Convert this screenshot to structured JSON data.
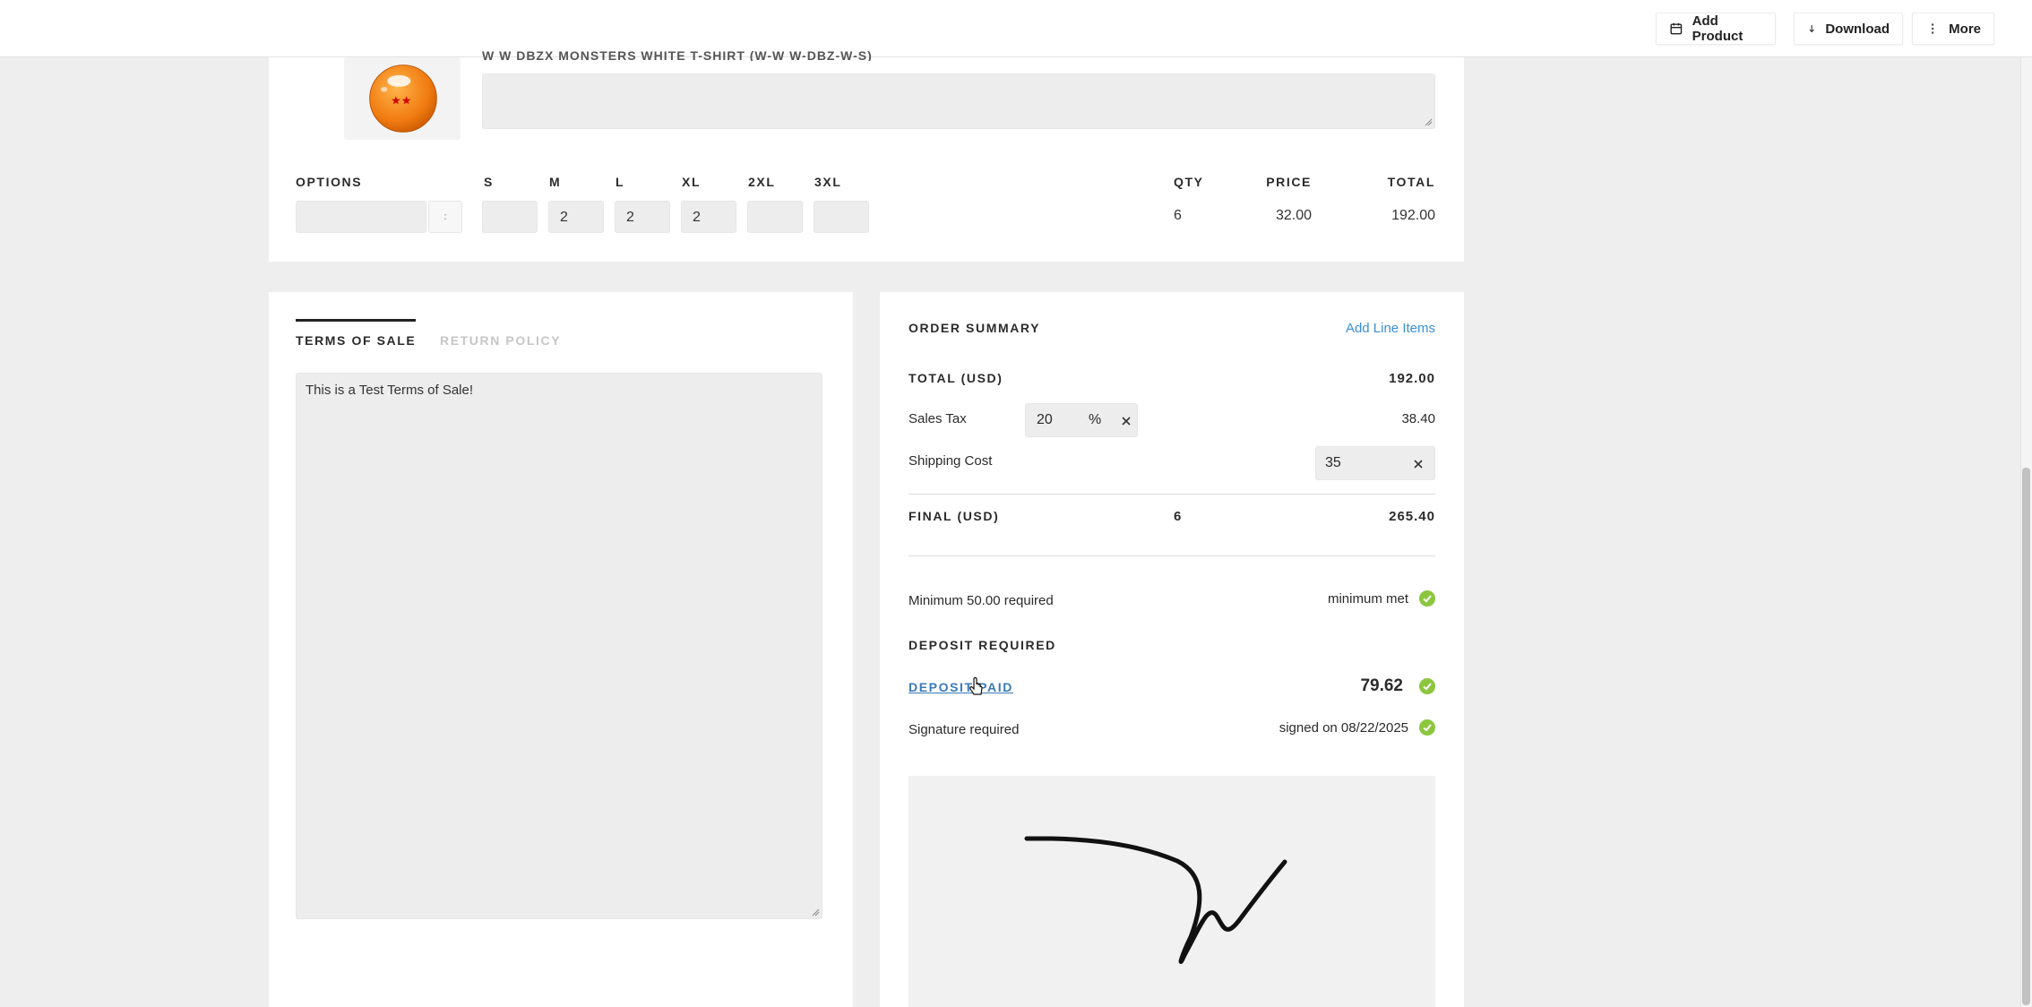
{
  "toolbar": {
    "add_product": "Add Product",
    "download": "Download",
    "more": "More"
  },
  "product": {
    "title_partial": "W W DBZX MONSTERS WHITE T-SHIRT (W-W W-DBZ-W-S)",
    "options_header": "OPTIONS",
    "sizes": [
      {
        "label": "S",
        "value": ""
      },
      {
        "label": "M",
        "value": "2"
      },
      {
        "label": "L",
        "value": "2"
      },
      {
        "label": "XL",
        "value": "2"
      },
      {
        "label": "2XL",
        "value": ""
      },
      {
        "label": "3XL",
        "value": ""
      }
    ],
    "qty_header": "QTY",
    "price_header": "PRICE",
    "total_header": "TOTAL",
    "qty": "6",
    "price": "32.00",
    "total": "192.00"
  },
  "terms": {
    "tab_terms": "TERMS OF SALE",
    "tab_return": "RETURN POLICY",
    "text": "This is a Test Terms of Sale!"
  },
  "summary": {
    "heading": "ORDER SUMMARY",
    "add_line_items": "Add Line Items",
    "total_label": "TOTAL (USD)",
    "total_value": "192.00",
    "sales_tax_label": "Sales Tax",
    "sales_tax_rate": "20",
    "sales_tax_unit": "%",
    "sales_tax_value": "38.40",
    "shipping_label": "Shipping Cost",
    "shipping_value": "35",
    "final_label": "FINAL (USD)",
    "final_qty": "6",
    "final_value": "265.40",
    "minimum_label": "Minimum 50.00 required",
    "minimum_status": "minimum met",
    "deposit_heading": "DEPOSIT REQUIRED",
    "deposit_link": "DEPOSIT PAID",
    "deposit_value": "79.62",
    "signature_label": "Signature required",
    "signature_status": "signed on 08/22/2025"
  },
  "colors": {
    "accent_link": "#3a8fd6",
    "check_green": "#8cc63f",
    "background": "#eeeeee",
    "card": "#ffffff"
  }
}
